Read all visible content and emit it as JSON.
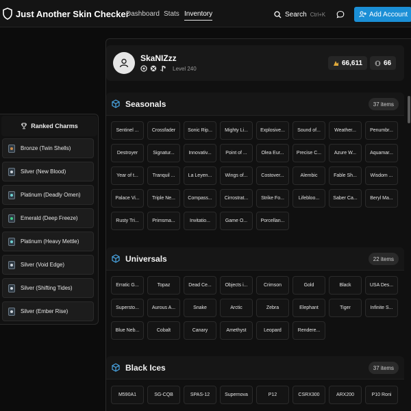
{
  "app": {
    "title": "Just Another Skin Checker"
  },
  "nav": {
    "items": [
      "Dashboard",
      "Stats",
      "Inventory"
    ],
    "active": "Inventory"
  },
  "search": {
    "label": "Search",
    "shortcut": "Ctrl+K"
  },
  "actions": {
    "add_account": "Add Account"
  },
  "profile": {
    "username": "SkaNIZzz",
    "level": "Level 240",
    "renown": "66,611",
    "credits": "66"
  },
  "charms": {
    "title": "Ranked Charms",
    "items": [
      {
        "label": "Bronze (Twin Shells)",
        "color": "#c98a4a"
      },
      {
        "label": "Silver (New Blood)",
        "color": "#cfd6dc"
      },
      {
        "label": "Platinum (Deadly Omen)",
        "color": "#6fd3d3"
      },
      {
        "label": "Emerald (Deep Freeze)",
        "color": "#3fd08a"
      },
      {
        "label": "Platinum (Heavy Mettle)",
        "color": "#6fd3d3"
      },
      {
        "label": "Silver (Void Edge)",
        "color": "#cfd6dc"
      },
      {
        "label": "Silver (Shifting Tides)",
        "color": "#cfd6dc"
      },
      {
        "label": "Silver (Ember Rise)",
        "color": "#cfd6dc"
      }
    ]
  },
  "sections": [
    {
      "title": "Seasonals",
      "count": "37 items",
      "items": [
        "Sentinel ...",
        "Crossfader",
        "Sonic Rip...",
        "Mighty Li...",
        "Explosive...",
        "Sound of...",
        "Weather...",
        "Penumbr...",
        "Destroyer",
        "Signatur...",
        "Innovativ...",
        "Point of ...",
        "Olea Eur...",
        "Precise C...",
        "Azure W...",
        "Aquamar...",
        "Year of t...",
        "Tranquil ...",
        "La Leyen...",
        "Wings of...",
        "Costover...",
        "Alembic",
        "Fable Sh...",
        "Wisdom ...",
        "Palace Vi...",
        "Triple Ne...",
        "Compass...",
        "Cirrostrat...",
        "Strike Fo...",
        "Lifebloo...",
        "Saber Ca...",
        "Beryl Ma...",
        "Rusty Tri...",
        "Primsma...",
        "Invitatio...",
        "Game O...",
        "Porcellan..."
      ]
    },
    {
      "title": "Universals",
      "count": "22 items",
      "items": [
        "Erratic G...",
        "Topaz",
        "Dead Ce...",
        "Objects i...",
        "Crimson",
        "Gold",
        "Black",
        "USA Des...",
        "Supersto...",
        "Aurous A...",
        "Snake",
        "Arctic",
        "Zebra",
        "Elephant",
        "Tiger",
        "Infinite S...",
        "Blue Neb...",
        "Cobalt",
        "Canary",
        "Amethyst",
        "Leopard",
        "Rendere..."
      ]
    },
    {
      "title": "Black Ices",
      "count": "37 items",
      "items": [
        "M590A1",
        "SG-CQB",
        "SPAS-12",
        "Supernova",
        "P12",
        "CSRX300",
        "ARX200",
        "P10 Roni"
      ]
    }
  ]
}
